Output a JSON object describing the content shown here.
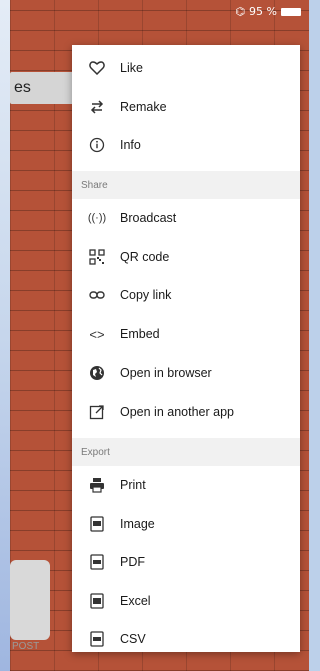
{
  "status": {
    "battery_percent_text": "95 %"
  },
  "page": {
    "header_fragment": "es",
    "post_fragment": "POST"
  },
  "menu": {
    "items_top": [
      {
        "label": "Like",
        "icon": "heart-icon"
      },
      {
        "label": "Remake",
        "icon": "repeat-icon"
      },
      {
        "label": "Info",
        "icon": "info-icon"
      }
    ],
    "share_header": "Share",
    "share_items": [
      {
        "label": "Broadcast",
        "icon": "broadcast-icon"
      },
      {
        "label": "QR code",
        "icon": "qr-code-icon"
      },
      {
        "label": "Copy link",
        "icon": "link-icon"
      },
      {
        "label": "Embed",
        "icon": "code-icon"
      },
      {
        "label": "Open in browser",
        "icon": "globe-icon"
      },
      {
        "label": "Open in another app",
        "icon": "external-app-icon"
      }
    ],
    "export_header": "Export",
    "export_items": [
      {
        "label": "Print",
        "icon": "printer-icon"
      },
      {
        "label": "Image",
        "icon": "image-file-icon"
      },
      {
        "label": "PDF",
        "icon": "pdf-file-icon"
      },
      {
        "label": "Excel",
        "icon": "excel-file-icon"
      },
      {
        "label": "CSV",
        "icon": "csv-file-icon"
      }
    ]
  }
}
